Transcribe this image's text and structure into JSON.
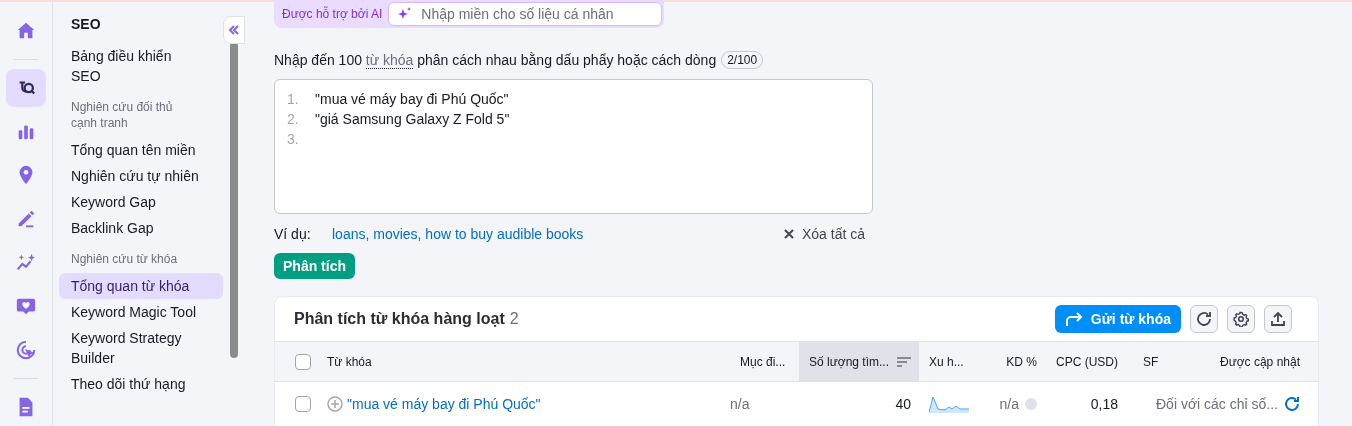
{
  "rail": {
    "items": [
      {
        "kind": "home",
        "selected": false
      },
      {
        "kind": "divider"
      },
      {
        "kind": "seo",
        "selected": true
      },
      {
        "kind": "chart",
        "selected": false
      },
      {
        "kind": "pin",
        "selected": false
      },
      {
        "kind": "pen",
        "selected": false
      },
      {
        "kind": "sparkle",
        "selected": false
      },
      {
        "kind": "heart",
        "selected": false
      },
      {
        "kind": "target",
        "selected": false
      },
      {
        "kind": "divider"
      },
      {
        "kind": "document",
        "selected": false
      }
    ]
  },
  "sidebar": {
    "title": "SEO",
    "items": [
      {
        "kind": "link",
        "label": "Bảng điều khiển SEO",
        "selected": false
      },
      {
        "kind": "heading",
        "label": "Nghiên cứu đối thủ cạnh tranh"
      },
      {
        "kind": "link",
        "label": "Tổng quan tên miền",
        "selected": false
      },
      {
        "kind": "link",
        "label": "Nghiên cứu tự nhiên",
        "selected": false
      },
      {
        "kind": "link",
        "label": "Keyword Gap",
        "selected": false
      },
      {
        "kind": "link",
        "label": "Backlink Gap",
        "selected": false
      },
      {
        "kind": "heading",
        "label": "Nghiên cứu từ khóa"
      },
      {
        "kind": "link",
        "label": "Tổng quan từ khóa",
        "selected": true
      },
      {
        "kind": "link",
        "label": "Keyword Magic Tool",
        "selected": false
      },
      {
        "kind": "link",
        "label": "Keyword Strategy Builder",
        "selected": false
      },
      {
        "kind": "link",
        "label": "Theo dõi thứ hạng",
        "selected": false
      }
    ]
  },
  "ai_bar": {
    "label": "Được hỗ trợ bởi AI",
    "placeholder": "Nhập miền cho số liệu cá nhân"
  },
  "keyword_input": {
    "instruction": "Nhập đến 100 ",
    "term": "từ khóa",
    "instruction_rest": " phân cách nhau bằng dấu phẩy hoặc cách dòng",
    "counter": "2/100",
    "lines": [
      {
        "number": "1.",
        "text": "\"mua vé máy bay đi Phú Quốc\""
      },
      {
        "number": "2.",
        "text": "\"giá Samsung Galaxy Z Fold 5\""
      },
      {
        "number": "3."
      }
    ],
    "example_label": "Ví dụ:",
    "example_link": "loans, movies, how to buy audible books",
    "clear": "Xóa tất cả",
    "submit": "Phân tích"
  },
  "table": {
    "title": "Phân tích từ khóa hàng loạt",
    "count": "2",
    "send_button": "Gửi từ khóa",
    "all_checked": false,
    "columns": [
      {
        "label": "Từ khóa",
        "sorted": false
      },
      {
        "label": "Mục đi...",
        "sorted": false
      },
      {
        "label": "Số lượng tìm...",
        "sorted": true
      },
      {
        "label": "Xu h...",
        "sorted": false
      },
      {
        "label": "KD %",
        "sorted": false
      },
      {
        "label": "CPC (USD)",
        "sorted": false
      },
      {
        "label": "SF",
        "sorted": false
      },
      {
        "label": "Được cập nhật",
        "sorted": false
      }
    ],
    "rows": [
      {
        "checked": false,
        "keyword": "\"mua vé máy bay đi Phú Quốc\"",
        "intent": "n/a",
        "volume": "40",
        "kd": "n/a",
        "cpc": "0,18",
        "updated": "Đối với các chỉ số..."
      }
    ]
  }
}
